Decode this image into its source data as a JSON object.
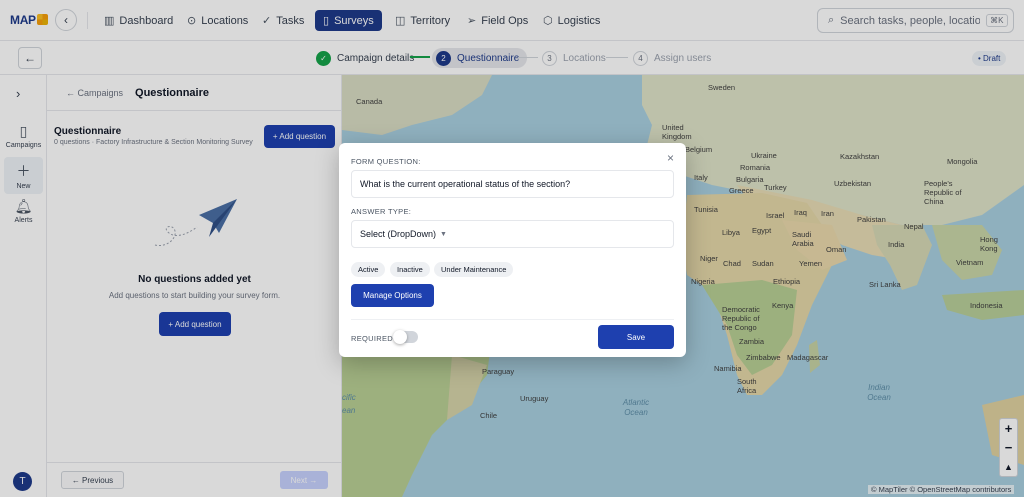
{
  "brand": {
    "logo_text": "MAP"
  },
  "topnav": {
    "items": [
      {
        "label": "Dashboard",
        "icon": "bar-chart-icon"
      },
      {
        "label": "Locations",
        "icon": "pin-icon"
      },
      {
        "label": "Tasks",
        "icon": "check-icon"
      },
      {
        "label": "Surveys",
        "icon": "clipboard-icon",
        "active": true
      },
      {
        "label": "Territory",
        "icon": "map-icon"
      },
      {
        "label": "Field Ops",
        "icon": "send-icon"
      },
      {
        "label": "Logistics",
        "icon": "box-icon"
      }
    ],
    "search_placeholder": "Search tasks, people, locations...",
    "search_shortcut": "⌘K"
  },
  "stepper": {
    "steps": [
      {
        "num": "✓",
        "label": "Campaign details",
        "state": "done"
      },
      {
        "num": "2",
        "label": "Questionnaire",
        "state": "current"
      },
      {
        "num": "3",
        "label": "Locations",
        "state": "pending"
      },
      {
        "num": "4",
        "label": "Assign users",
        "state": "pending"
      }
    ],
    "status_badge": "• Draft"
  },
  "rail": {
    "items": [
      {
        "label": "Campaigns",
        "icon": "clipboard-icon"
      },
      {
        "label": "New",
        "icon": "plus-icon",
        "active": true
      },
      {
        "label": "Alerts",
        "icon": "bell-icon"
      }
    ],
    "avatar_initial": "T"
  },
  "panel": {
    "breadcrumb": "← Campaigns",
    "title": "Questionnaire",
    "section_title": "Questionnaire",
    "section_subtitle": "0 questions · Factory Infrastructure & Section Monitoring Survey",
    "add_question_top": "+ Add question",
    "empty_title": "No questions added yet",
    "empty_subtitle": "Add questions to start building your survey form.",
    "add_question_center": "+ Add question",
    "prev_label": "← Previous",
    "next_label": "Next →"
  },
  "map": {
    "labels": [
      "Canada",
      "Sweden",
      "United Kingdom",
      "Belgium",
      "Ukraine",
      "Romania",
      "Italy",
      "Bulgaria",
      "Greece",
      "Turkey",
      "Kazakhstan",
      "Mongolia",
      "Uzbekistan",
      "People's Republic of China",
      "Tunisia",
      "Israel",
      "Iraq",
      "Iran",
      "Pakistan",
      "Nepal",
      "India",
      "Hong Kong",
      "Libya",
      "Egypt",
      "Saudi Arabia",
      "Oman",
      "Niger",
      "Chad",
      "Sudan",
      "Yemen",
      "Vietnam",
      "Nigeria",
      "Ethiopia",
      "Sri Lanka",
      "Democratic Republic of the Congo",
      "Kenya",
      "Indonesia",
      "Zambia",
      "Zimbabwe",
      "Madagascar",
      "Namibia",
      "South Africa",
      "Paraguay",
      "Uruguay",
      "Chile",
      "Atlantic Ocean",
      "Indian Ocean",
      "cific",
      "ean"
    ],
    "zoom_in": "+",
    "zoom_out": "−",
    "compass": "▲",
    "attribution": "© MapTiler © OpenStreetMap contributors"
  },
  "modal": {
    "question_label": "FORM QUESTION:",
    "question_value": "What is the current operational status of the section?",
    "answer_type_label": "ANSWER TYPE:",
    "answer_type_value": "Select (DropDown)",
    "options": [
      "Active",
      "Inactive",
      "Under Maintenance"
    ],
    "manage_options_label": "Manage Options",
    "required_label": "REQUIRED",
    "required": false,
    "save_label": "Save"
  }
}
